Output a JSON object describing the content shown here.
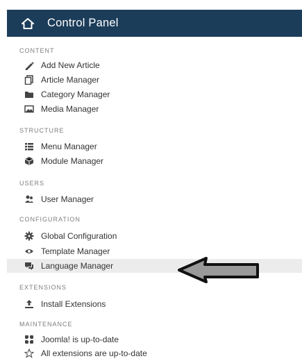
{
  "header": {
    "title": "Control Panel",
    "icon": "home-icon"
  },
  "sections": [
    {
      "heading": "CONTENT",
      "items": [
        {
          "label": "Add New Article",
          "icon": "pencil-icon"
        },
        {
          "label": "Article Manager",
          "icon": "stack-icon"
        },
        {
          "label": "Category Manager",
          "icon": "folder-icon"
        },
        {
          "label": "Media Manager",
          "icon": "image-icon"
        }
      ]
    },
    {
      "heading": "STRUCTURE",
      "items": [
        {
          "label": "Menu Manager",
          "icon": "list-icon"
        },
        {
          "label": "Module Manager",
          "icon": "cube-icon"
        }
      ]
    },
    {
      "heading": "USERS",
      "items": [
        {
          "label": "User Manager",
          "icon": "users-icon"
        }
      ]
    },
    {
      "heading": "CONFIGURATION",
      "items": [
        {
          "label": "Global Configuration",
          "icon": "gear-icon"
        },
        {
          "label": "Template Manager",
          "icon": "eye-icon"
        },
        {
          "label": "Language Manager",
          "icon": "speech-bubbles-icon",
          "highlighted": true
        }
      ]
    },
    {
      "heading": "EXTENSIONS",
      "items": [
        {
          "label": "Install Extensions",
          "icon": "upload-icon"
        }
      ]
    },
    {
      "heading": "MAINTENANCE",
      "items": [
        {
          "label": "Joomla! is up-to-date",
          "icon": "joomla-icon"
        },
        {
          "label": "All extensions are up-to-date",
          "icon": "star-icon"
        }
      ]
    }
  ],
  "colors": {
    "header_bg": "#1c3d5a",
    "highlight_bg": "#ececec",
    "arrow_fill": "#9a9a9a"
  }
}
